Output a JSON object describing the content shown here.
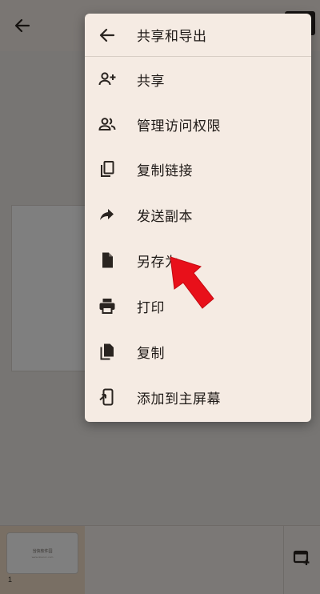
{
  "background": {
    "thumbnail": {
      "title": "当快软件园",
      "subtitle": "www.downcc.com",
      "number": "1"
    }
  },
  "menu": {
    "header": {
      "label": "共享和导出",
      "icon": "arrow-back-icon"
    },
    "items": [
      {
        "label": "共享",
        "icon": "person-add-icon"
      },
      {
        "label": "管理访问权限",
        "icon": "people-icon"
      },
      {
        "label": "复制链接",
        "icon": "copy-link-icon"
      },
      {
        "label": "发送副本",
        "icon": "forward-icon"
      },
      {
        "label": "另存为",
        "icon": "file-icon"
      },
      {
        "label": "打印",
        "icon": "print-icon"
      },
      {
        "label": "复制",
        "icon": "duplicate-icon"
      },
      {
        "label": "添加到主屏幕",
        "icon": "add-to-home-screen-icon"
      }
    ]
  },
  "annotation": {
    "color": "#e8101a",
    "points_to": "另存为"
  },
  "colors": {
    "menu_background": "#f5ebe3",
    "thumbnail_selected": "#f2dfc8",
    "scrim": "rgba(0,0,0,0.5)"
  }
}
